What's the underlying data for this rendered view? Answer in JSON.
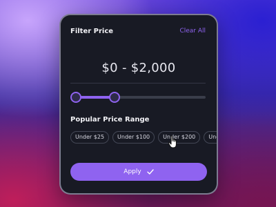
{
  "header": {
    "title": "Filter Price",
    "clear_label": "Clear All"
  },
  "price_range": {
    "label": "$0 - $2,000",
    "min_value": 0,
    "max_value": 2000,
    "selected_min": 0,
    "selected_max": 2000
  },
  "slider": {
    "start_fraction": 0.0,
    "end_fraction": 0.3
  },
  "popular": {
    "heading": "Popular Price Range",
    "chips": [
      "Under $25",
      "Under $100",
      "Under $200",
      "Under"
    ]
  },
  "apply_button": {
    "label": "Apply",
    "icon": "check-icon"
  },
  "colors": {
    "accent": "#8f63f0",
    "card": "#181a24",
    "text": "#f2f2f6"
  },
  "cursor": {
    "icon": "hand-pointer-icon"
  }
}
